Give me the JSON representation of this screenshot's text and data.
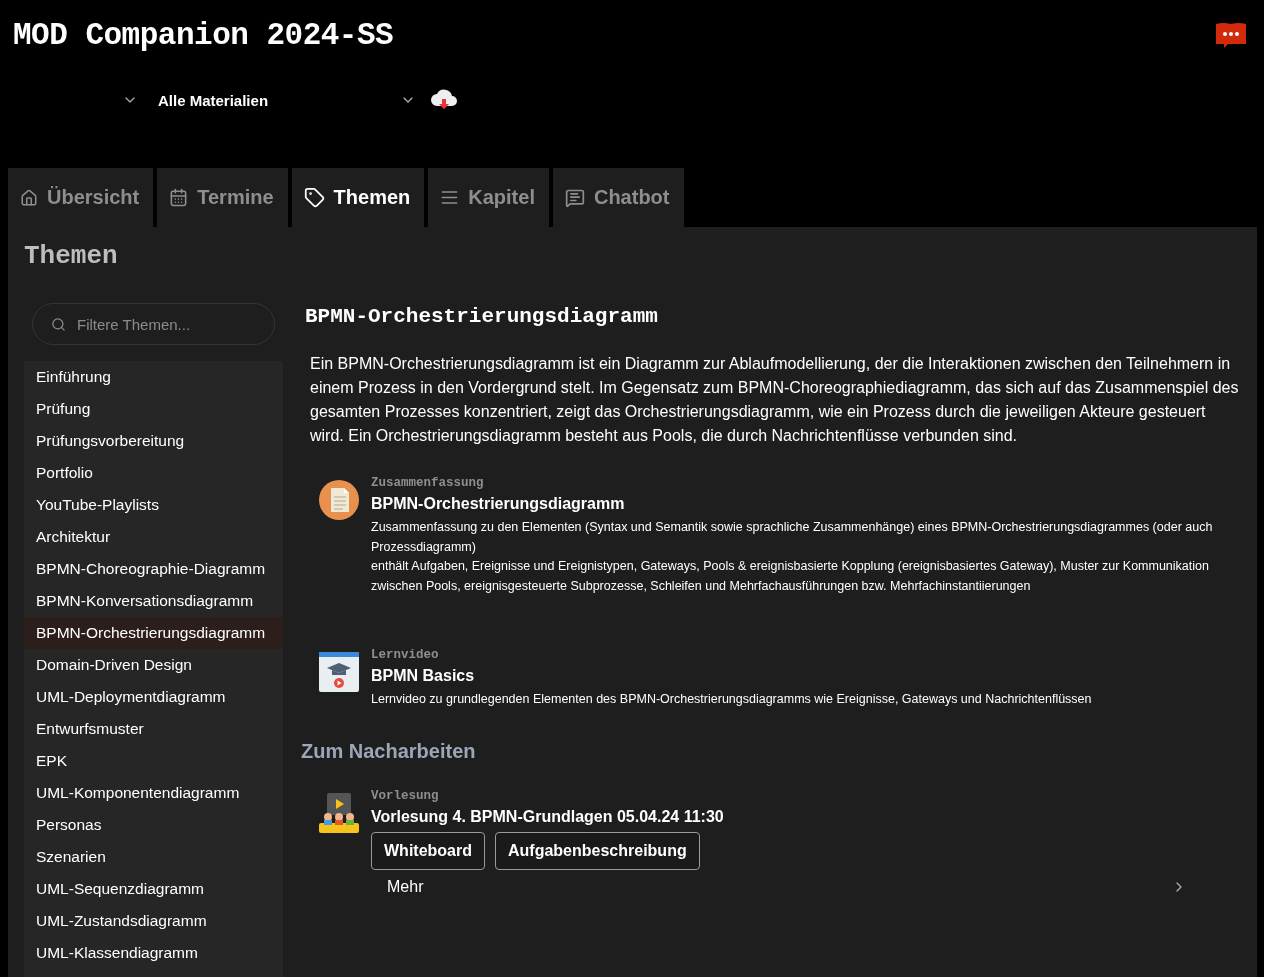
{
  "app": {
    "title": "MOD Companion 2024-SS"
  },
  "filters": {
    "material": "Alle Materialien"
  },
  "tabs": [
    {
      "label": "Übersicht",
      "kind": "home",
      "selected": false
    },
    {
      "label": "Termine",
      "kind": "calendar",
      "selected": false
    },
    {
      "label": "Themen",
      "kind": "tag",
      "selected": true
    },
    {
      "label": "Kapitel",
      "kind": "list",
      "selected": false
    },
    {
      "label": "Chatbot",
      "kind": "chat",
      "selected": false
    }
  ],
  "panel": {
    "title": "Themen"
  },
  "sidebar": {
    "search": {
      "placeholder": "Filtere Themen..."
    },
    "items": [
      {
        "label": "Einführung",
        "selected": false
      },
      {
        "label": "Prüfung",
        "selected": false
      },
      {
        "label": "Prüfungsvorbereitung",
        "selected": false
      },
      {
        "label": "Portfolio",
        "selected": false
      },
      {
        "label": "YouTube-Playlists",
        "selected": false
      },
      {
        "label": "Architektur",
        "selected": false
      },
      {
        "label": "BPMN-Choreographie-Diagramm",
        "selected": false
      },
      {
        "label": "BPMN-Konversationsdiagramm",
        "selected": false
      },
      {
        "label": "BPMN-Orchestrierungsdiagramm",
        "selected": true
      },
      {
        "label": "Domain-Driven Design",
        "selected": false
      },
      {
        "label": "UML-Deploymentdiagramm",
        "selected": false
      },
      {
        "label": "Entwurfsmuster",
        "selected": false
      },
      {
        "label": "EPK",
        "selected": false
      },
      {
        "label": "UML-Komponentendiagramm",
        "selected": false
      },
      {
        "label": "Personas",
        "selected": false
      },
      {
        "label": "Szenarien",
        "selected": false
      },
      {
        "label": "UML-Sequenzdiagramm",
        "selected": false
      },
      {
        "label": "UML-Zustandsdiagramm",
        "selected": false
      },
      {
        "label": "UML-Klassendiagramm",
        "selected": false
      }
    ]
  },
  "topic": {
    "title": "BPMN-Orchestrierungsdiagramm",
    "description": "Ein BPMN-Orchestrierungsdiagramm ist ein Diagramm zur Ablaufmodellierung, der die Interaktionen zwischen den Teilnehmern in einem Prozess in den Vordergrund stelt. Im Gegensatz zum BPMN-Choreographiediagramm, das sich auf das Zusammenspiel des gesamten Prozesses konzentriert, zeigt das Orchestrierungsdiagramm, wie ein Prozess durch die jeweiligen Akteure gesteuert wird. Ein Orchestrierungsdiagramm besteht aus Pools, die durch Nachrichtenflüsse verbunden sind.",
    "materials": [
      {
        "kind": "summary",
        "category": "Zusammenfassung",
        "title": "BPMN-Orchestrierungsdiagramm",
        "lines": [
          "Zusammenfassung zu den Elementen (Syntax und Semantik sowie sprachliche Zusammenhänge) eines BPMN-Orchestrierungsdiagrammes (oder auch Prozessdiagramm)",
          "enthält Aufgaben, Ereignisse und Ereignistypen, Gateways, Pools & ereignisbasierte Kopplung (ereignisbasiertes Gateway), Muster zur Kommunikation zwischen Pools, ereignisgesteuerte Subprozesse, Schleifen und Mehrfachausführungen bzw. Mehrfachinstantiierungen"
        ]
      },
      {
        "kind": "video",
        "category": "Lernvideo",
        "title": "BPMN Basics",
        "lines": [
          "Lernvideo zu grundlegenden Elementen des BPMN-Orchestrierungsdiagramms wie Ereignisse, Gateways und Nachrichtenflüssen"
        ]
      }
    ]
  },
  "review": {
    "title": "Zum Nacharbeiten",
    "items": [
      {
        "kind": "lecture",
        "category": "Vorlesung",
        "title": "Vorlesung 4. BPMN-Grundlagen 05.04.24 11:30",
        "buttons": [
          "Whiteboard",
          "Aufgabenbeschreibung"
        ],
        "more": "Mehr"
      }
    ]
  }
}
